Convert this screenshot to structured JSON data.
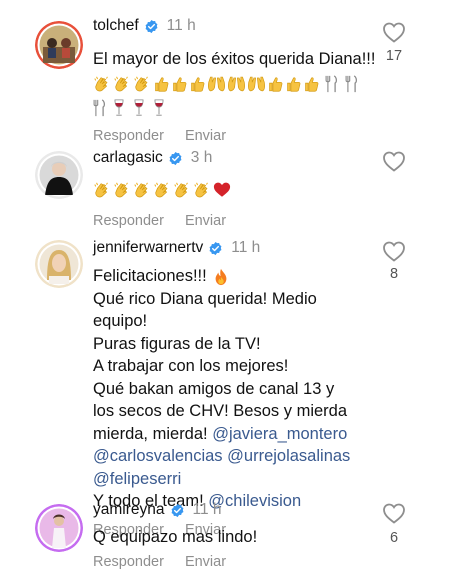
{
  "comments": [
    {
      "username": "tolchef",
      "time": "11 h",
      "text": "El mayor de los éxitos querida Diana!!!",
      "emojis": [
        "clapping-hands",
        "clapping-hands",
        "clapping-hands",
        "thumbs-up",
        "thumbs-up",
        "thumbs-up",
        "raising-hands",
        "raising-hands",
        "raising-hands",
        "thumbs-up",
        "thumbs-up",
        "thumbs-up",
        "fork-and-knife",
        "fork-and-knife",
        "fork-and-knife",
        "wine-glass",
        "wine-glass",
        "wine-glass"
      ],
      "likes": "17",
      "reply_label": "Responder",
      "send_label": "Enviar"
    },
    {
      "username": "carlagasic",
      "time": "3 h",
      "emojis": [
        "clapping-hands",
        "clapping-hands",
        "clapping-hands",
        "clapping-hands",
        "clapping-hands",
        "clapping-hands",
        "red-heart"
      ],
      "likes": "",
      "reply_label": "Responder",
      "send_label": "Enviar"
    },
    {
      "username": "jenniferwarnertv",
      "time": "11 h",
      "lines": [
        "Felicitaciones!!! ",
        "Qué rico Diana querida! Medio",
        "equipo!",
        "Puras figuras de la TV!",
        "A trabajar con los mejores!",
        "Qué bakan amigos de canal 13 y",
        "los secos de CHV! Besos y mierda",
        "mierda, mierda! "
      ],
      "mentions": {
        "m1": "@javiera_montero",
        "m2": "@carlosvalencias",
        "m3": "@urrejolasalinas",
        "m4": "@felipeserri",
        "m5": "@chilevision"
      },
      "tail_text": "Y todo el team! ",
      "likes": "8",
      "reply_label": "Responder",
      "send_label": "Enviar"
    },
    {
      "username": "yamireyna",
      "time": "11 h",
      "text": "Q equipazo mas lindo!",
      "likes": "6",
      "reply_label": "Responder",
      "send_label": "Enviar"
    }
  ],
  "colors": {
    "verified_blue": "#3897f0",
    "mention": "#3a5a8f",
    "muted": "#8e8e8e"
  }
}
